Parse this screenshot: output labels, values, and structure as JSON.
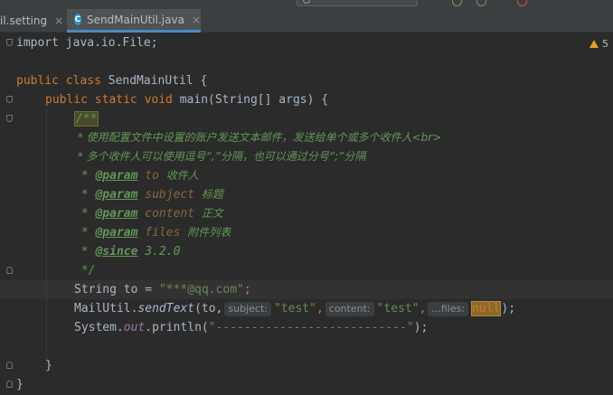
{
  "tabs": [
    {
      "label": "il.setting",
      "close": "×"
    },
    {
      "label": "SendMainUtil.java",
      "icon_letter": "C",
      "close": "×"
    }
  ],
  "warnings": {
    "count": "5"
  },
  "code": {
    "line1": "import java.io.File;",
    "line3_kw": "public class",
    "line3_name": " SendMainUtil {",
    "line4_kw": "public static void",
    "line4_rest": " main(String[] args) {",
    "doc_start": "/**",
    "doc1": " * 使用配置文件中设置的账户发送文本邮件，发送给单个或多个收件人<br>",
    "doc2": " * 多个收件人可以使用逗号“,”分隔，也可以通过分号“;”分隔",
    "doc_params": [
      {
        "star": " * ",
        "tag": "@param",
        "name": "to",
        "desc": "收件人"
      },
      {
        "star": " * ",
        "tag": "@param",
        "name": "subject",
        "desc": "标题"
      },
      {
        "star": " * ",
        "tag": "@param",
        "name": "content",
        "desc": "正文"
      },
      {
        "star": " * ",
        "tag": "@param",
        "name": "files",
        "desc": "附件列表"
      }
    ],
    "doc_since_star": " * ",
    "doc_since_tag": "@since",
    "doc_since_val": " 3.2.0",
    "doc_end": " */",
    "line_to_a": "String to = ",
    "line_to_str": "\"***@qq.com\"",
    "line_to_b": ";",
    "send_a": "MailUtil.",
    "send_method": "sendText",
    "send_b": "(to,",
    "hint_subject": "subject:",
    "send_subject": "\"test\"",
    "send_comma1": ",",
    "hint_content": "content:",
    "send_content": "\"test\"",
    "send_comma2": ",",
    "hint_files": "...files:",
    "send_null": "null",
    "send_end": ");",
    "print_a": "System.",
    "print_field": "out",
    "print_b": ".println(",
    "print_str": "\"---------------------------\"",
    "print_end": ");",
    "close_method": "}",
    "close_class": "}"
  }
}
